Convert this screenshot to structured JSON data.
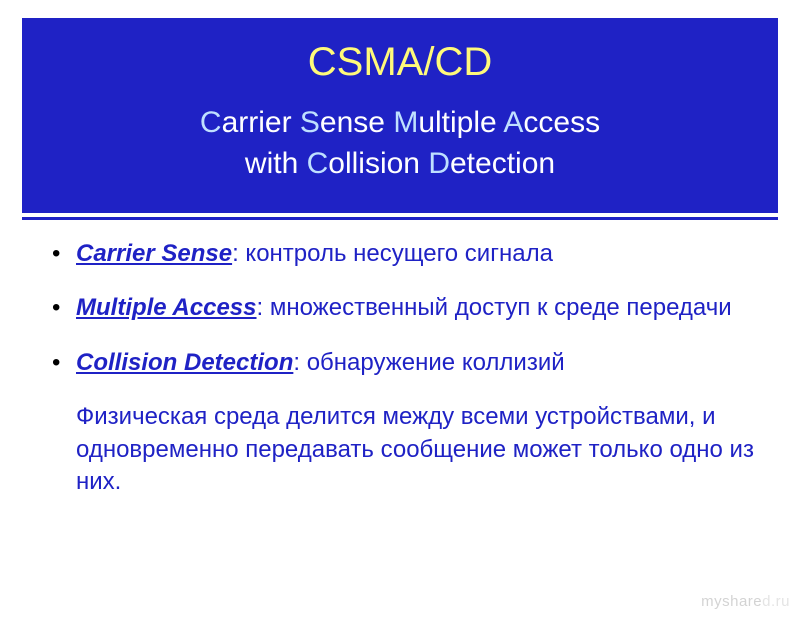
{
  "header": {
    "title": "CSMA/CD",
    "subtitle_segments": [
      {
        "t": "C",
        "hl": true
      },
      {
        "t": "arrier ",
        "hl": false
      },
      {
        "t": "S",
        "hl": true
      },
      {
        "t": "ense ",
        "hl": false
      },
      {
        "t": "M",
        "hl": true
      },
      {
        "t": "ultiple ",
        "hl": false
      },
      {
        "t": "A",
        "hl": true
      },
      {
        "t": "ccess",
        "hl": false
      },
      {
        "t": "\n",
        "hl": false
      },
      {
        "t": "with ",
        "hl": false
      },
      {
        "t": "C",
        "hl": true
      },
      {
        "t": "ollision ",
        "hl": false
      },
      {
        "t": "D",
        "hl": true
      },
      {
        "t": "etection",
        "hl": false
      }
    ]
  },
  "bullets": [
    {
      "term": "Carrier Sense",
      "desc": ": контроль несущего сигнала"
    },
    {
      "term": "Multiple Access",
      "desc": ": множественный доступ к среде передачи"
    },
    {
      "term": "Collision Detection",
      "desc": ": обнаружение коллизий"
    }
  ],
  "paragraph": "Физическая среда делится между всеми устройствами, и одновременно передавать сообщение может только одно из них.",
  "watermark": {
    "left": "myshare",
    "right": "d.ru"
  },
  "colors": {
    "header_bg": "#1f22c5",
    "title_yellow": "#fffa7a",
    "highlight_blue": "#bfe0ff",
    "body_text": "#1f22c5"
  }
}
